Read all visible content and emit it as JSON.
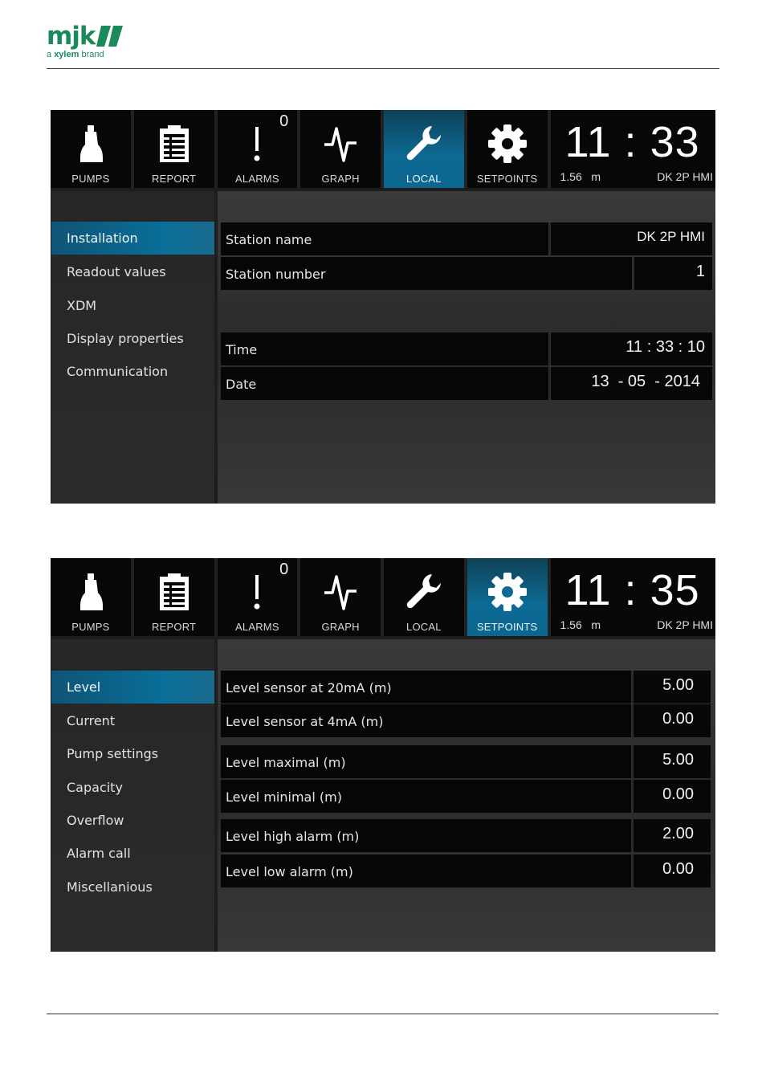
{
  "logo": {
    "mark": "mjk",
    "tag_prefix": "a ",
    "tag_brand": "xylem",
    "tag_suffix": " brand"
  },
  "colors": {
    "accent": "#0d6a94",
    "brand": "#1a8a5a",
    "panel": "#070707"
  },
  "screen1": {
    "toolbar": [
      {
        "label": "PUMPS",
        "icon": "pump-icon",
        "active": false
      },
      {
        "label": "REPORT",
        "icon": "report-icon",
        "active": false
      },
      {
        "label": "ALARMS",
        "icon": "alarm-icon",
        "badge": "0",
        "active": false
      },
      {
        "label": "GRAPH",
        "icon": "graph-icon",
        "active": false
      },
      {
        "label": "LOCAL",
        "icon": "wrench-icon",
        "active": true
      },
      {
        "label": "SETPOINTS",
        "icon": "gear-icon",
        "active": false
      }
    ],
    "clock": {
      "time": "11 : 33",
      "level": "1.56   m",
      "station": "DK 2P HMI"
    },
    "menu": [
      "Installation",
      "Readout values",
      "XDM",
      "Display properties",
      "Communication"
    ],
    "active_menu": "Installation",
    "rows": [
      {
        "label": "Station name",
        "value": "DK 2P HMI"
      },
      {
        "label": "Station number",
        "value": "1"
      },
      {
        "label": "Time",
        "value": "11 : 33 : 10"
      },
      {
        "label": "Date",
        "value": "13  - 05  - 2014"
      }
    ]
  },
  "screen2": {
    "toolbar": [
      {
        "label": "PUMPS",
        "icon": "pump-icon",
        "active": false
      },
      {
        "label": "REPORT",
        "icon": "report-icon",
        "active": false
      },
      {
        "label": "ALARMS",
        "icon": "alarm-icon",
        "badge": "0",
        "active": false
      },
      {
        "label": "GRAPH",
        "icon": "graph-icon",
        "active": false
      },
      {
        "label": "LOCAL",
        "icon": "wrench-icon",
        "active": false
      },
      {
        "label": "SETPOINTS",
        "icon": "gear-icon",
        "active": true
      }
    ],
    "clock": {
      "time": "11 : 35",
      "level": "1.56   m",
      "station": "DK 2P HMI"
    },
    "menu": [
      "Level",
      "Current",
      "Pump settings",
      "Capacity",
      "Overflow",
      "Alarm call",
      "Miscellanious"
    ],
    "active_menu": "Level",
    "rows": [
      {
        "label": "Level sensor at 20mA (m)",
        "value": "5.00"
      },
      {
        "label": "Level sensor at 4mA (m)",
        "value": "0.00"
      },
      {
        "label": "Level maximal (m)",
        "value": "5.00"
      },
      {
        "label": "Level minimal (m)",
        "value": "0.00"
      },
      {
        "label": "Level high alarm (m)",
        "value": "2.00"
      },
      {
        "label": "Level low alarm (m)",
        "value": "0.00"
      }
    ]
  }
}
